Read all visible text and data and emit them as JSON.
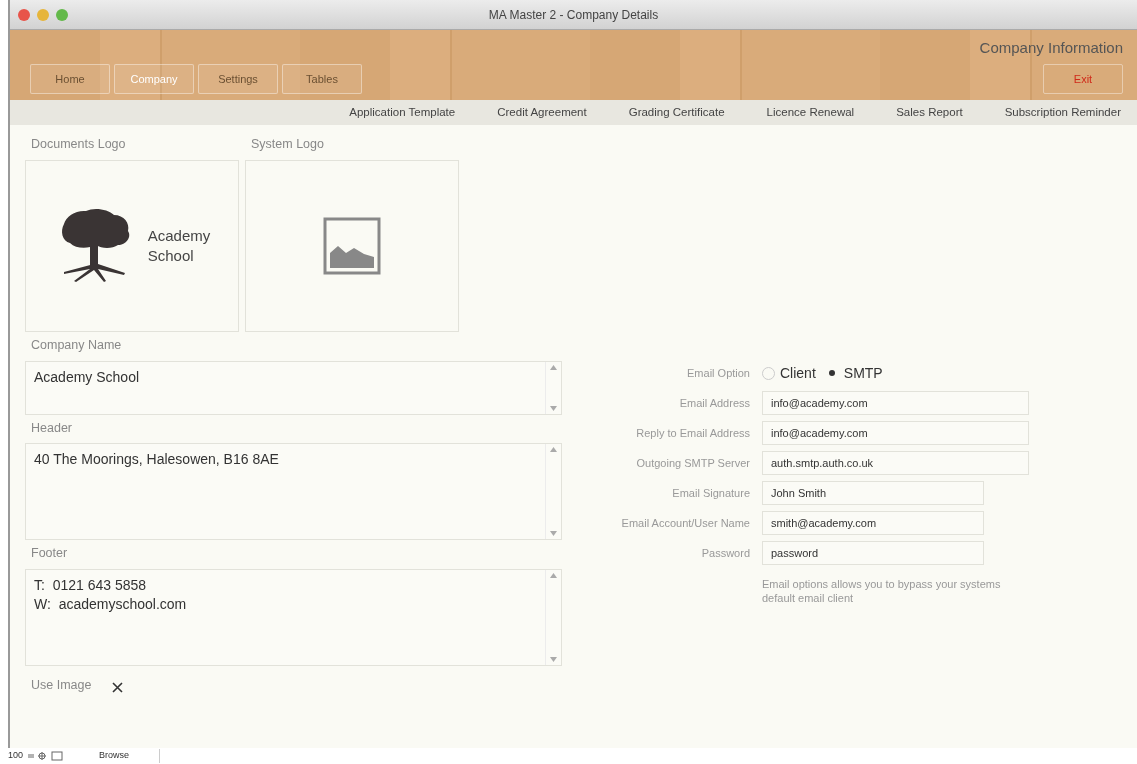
{
  "window": {
    "title": "MA Master 2 - Company Details"
  },
  "header": {
    "title": "Company Information",
    "exit_button": "Exit"
  },
  "nav_tabs": [
    {
      "label": "Home",
      "selected": false
    },
    {
      "label": "Company",
      "selected": true
    },
    {
      "label": "Settings",
      "selected": false
    },
    {
      "label": "Tables",
      "selected": false
    }
  ],
  "report_links": [
    "Application Template",
    "Credit Agreement",
    "Grading Certificate",
    "Licence Renewal",
    "Sales Report",
    "Subscription Reminder"
  ],
  "logos": [
    {
      "label": "Documents Logo",
      "kind": "logo",
      "text": [
        "Academy",
        "School"
      ]
    },
    {
      "label": "System Logo",
      "kind": "placeholder"
    }
  ],
  "text_fields": [
    {
      "label": "Company Name",
      "lines": [
        "Academy School"
      ]
    },
    {
      "label": "Header",
      "lines": [
        "40 The Moorings, Halesowen, B16 8AE"
      ]
    },
    {
      "label": "Footer",
      "lines": [
        "T:  0121 643 5858",
        "W:  academyschool.com"
      ]
    }
  ],
  "use_image": {
    "label": "Use Image",
    "checked": true
  },
  "email_option": {
    "label": "Email Option",
    "options": [
      {
        "label": "Client",
        "selected": false
      },
      {
        "label": "SMTP",
        "selected": true
      }
    ]
  },
  "email_fields": [
    {
      "label": "Email Address",
      "value": "info@academy.com"
    },
    {
      "label": "Reply to Email Address",
      "value": "info@academy.com"
    },
    {
      "label": "Outgoing SMTP Server",
      "value": "auth.smtp.auth.co.uk"
    },
    {
      "label": "Email Signature",
      "value": "John Smith"
    },
    {
      "label": "Email Account/User Name",
      "value": "smith@academy.com"
    },
    {
      "label": "Password",
      "value": "password"
    }
  ],
  "email_note": "Email options allows you to bypass your systems default email client",
  "status_bar": {
    "zoom": "100",
    "mode": "Browse"
  }
}
